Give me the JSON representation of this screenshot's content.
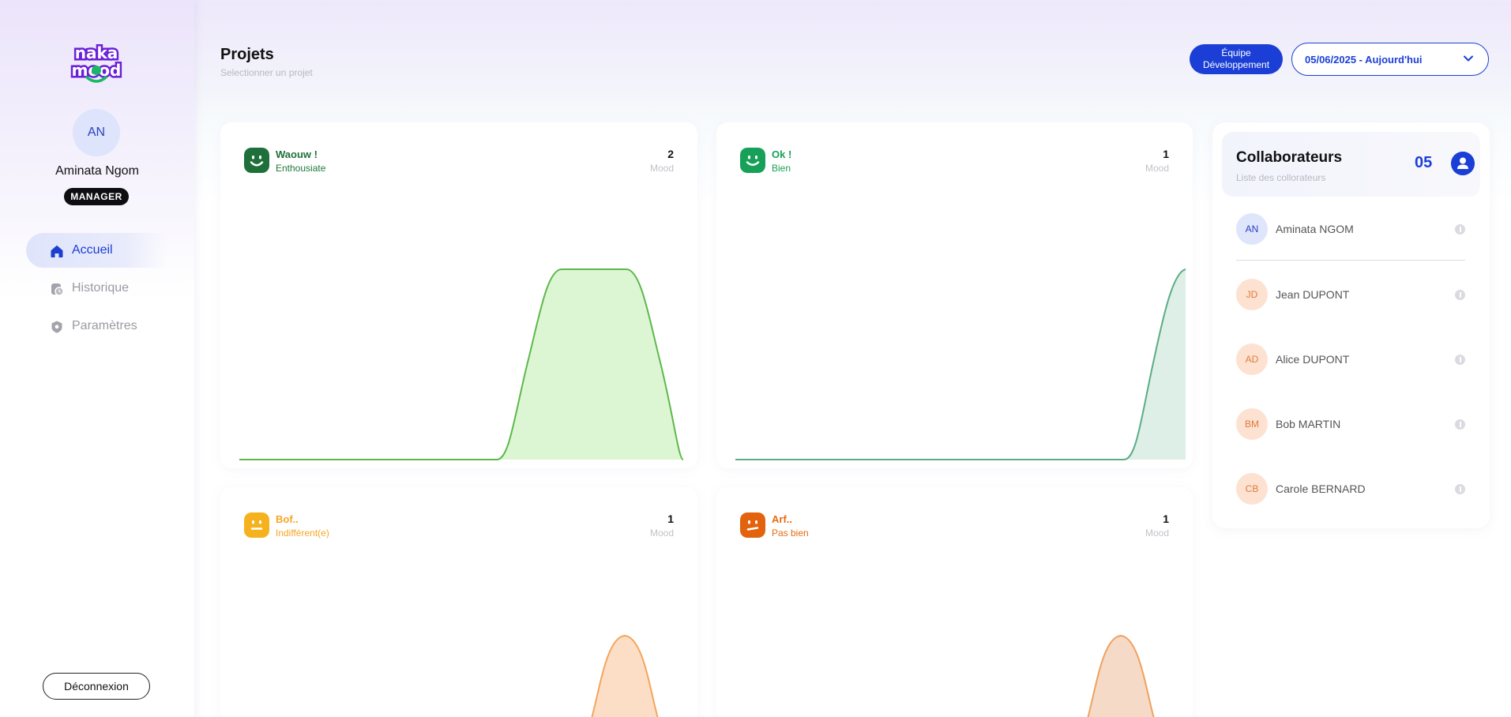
{
  "brand": {
    "logo_text_top": "naka",
    "logo_text_bottom": "mood"
  },
  "user": {
    "initials": "AN",
    "name": "Aminata Ngom",
    "role": "MANAGER"
  },
  "nav": {
    "items": [
      {
        "label": "Accueil",
        "icon": "home-icon",
        "active": true
      },
      {
        "label": "Historique",
        "icon": "history-icon",
        "active": false
      },
      {
        "label": "Paramètres",
        "icon": "settings-icon",
        "active": false
      }
    ],
    "logout_label": "Déconnexion"
  },
  "header": {
    "title": "Projets",
    "subtitle": "Selectionner un projet",
    "team_label": "Équipe Développement",
    "date_label": "05/06/2025 - Aujourd'hui"
  },
  "moods": [
    {
      "title": "Waouw !",
      "subtitle": "Enthousiate",
      "count": "2",
      "count_label": "Mood",
      "color": "#1f7a3a",
      "chart_color": "#5db84a",
      "fill": "#d6f5cc",
      "face": "smile"
    },
    {
      "title": "Ok !",
      "subtitle": "Bien",
      "count": "1",
      "count_label": "Mood",
      "color": "#17a057",
      "chart_color": "#5aad84",
      "fill": "#d9ede3",
      "face": "smile"
    },
    {
      "title": "Bof..",
      "subtitle": "Indifférent(e)",
      "count": "1",
      "count_label": "Mood",
      "color": "#f6a623",
      "chart_color": "#f5a55c",
      "fill": "#fbd8bd",
      "face": "neutral"
    },
    {
      "title": "Arf..",
      "subtitle": "Pas bien",
      "count": "1",
      "count_label": "Mood",
      "color": "#e86a10",
      "chart_color": "#f0a15e",
      "fill": "#f2d4bd",
      "face": "meh"
    }
  ],
  "collaborators": {
    "title": "Collaborateurs",
    "subtitle": "Liste des collorateurs",
    "count": "05",
    "people": [
      {
        "initials": "AN",
        "name": "Aminata NGOM",
        "bg": "#dfe5fb",
        "fg": "#2a3fbf"
      },
      {
        "initials": "JD",
        "name": "Jean DUPONT",
        "bg": "#fde2d2",
        "fg": "#e07a3c"
      },
      {
        "initials": "AD",
        "name": "Alice DUPONT",
        "bg": "#fde2d2",
        "fg": "#e07a3c"
      },
      {
        "initials": "BM",
        "name": "Bob MARTIN",
        "bg": "#fde2d2",
        "fg": "#e07a3c"
      },
      {
        "initials": "CB",
        "name": "Carole BERNARD",
        "bg": "#fde2d2",
        "fg": "#e07a3c"
      }
    ]
  },
  "colors": {
    "accent": "#1b3fd6",
    "sidebar_active": "#1d3fd1"
  }
}
